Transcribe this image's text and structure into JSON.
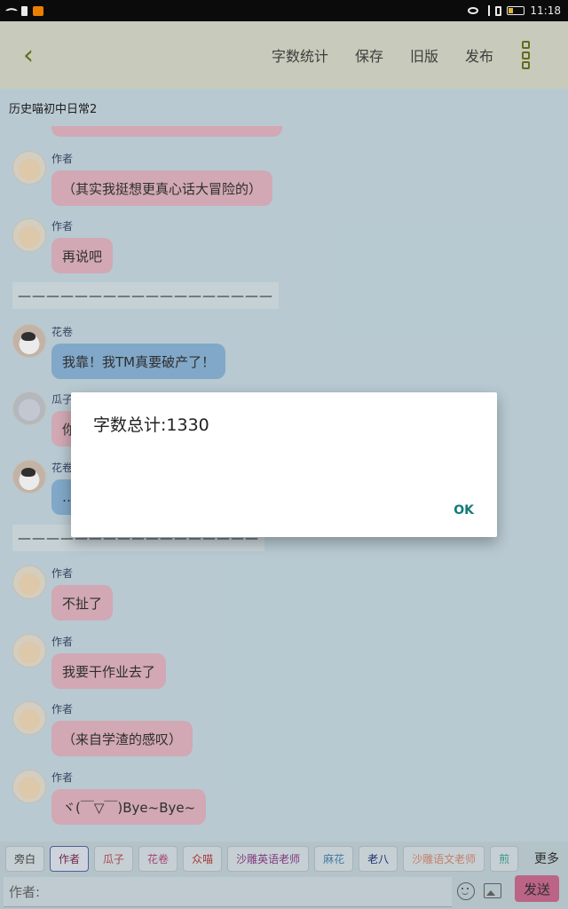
{
  "status_bar": {
    "time": "11:18"
  },
  "header": {
    "back_icon": "chevron-left-icon",
    "actions": [
      "字数统计",
      "保存",
      "旧版",
      "发布"
    ],
    "more_icon": "more-vertical-icon"
  },
  "document_title": "历史喵初中日常2",
  "messages": [
    {
      "speaker": "作者",
      "text": "（其实我挺想更真心话大冒险的）",
      "color": "pink"
    },
    {
      "speaker": "作者",
      "text": "再说吧",
      "color": "pink"
    },
    {
      "divider": "——————————————————"
    },
    {
      "speaker": "花卷",
      "text": "我靠！我TM真要破产了！",
      "color": "blue"
    },
    {
      "speaker": "瓜子",
      "text": "你",
      "color": "pink"
    },
    {
      "speaker": "花卷",
      "text": "…",
      "color": "blue"
    },
    {
      "divider": "—————————————————"
    },
    {
      "speaker": "作者",
      "text": "不扯了",
      "color": "pink"
    },
    {
      "speaker": "作者",
      "text": "我要干作业去了",
      "color": "pink"
    },
    {
      "speaker": "作者",
      "text": "（来自学渣的感叹）",
      "color": "pink"
    },
    {
      "speaker": "作者",
      "text": "ヾ(￣▽￣)Bye~Bye~",
      "color": "pink"
    }
  ],
  "dialog": {
    "title": "字数总计:1330",
    "ok_label": "OK"
  },
  "roles": {
    "items": [
      "旁白",
      "作者",
      "瓜子",
      "花卷",
      "众喵",
      "沙雕英语老师",
      "麻花",
      "老八",
      "沙雕语文老师",
      "煎"
    ],
    "selected": "作者",
    "more_label": "更多"
  },
  "input": {
    "placeholder": "作者:",
    "send_label": "发送"
  },
  "colors": {
    "accent": "#6e7520",
    "pink_bubble": "#e3b7c3",
    "blue_bubble": "#8db7da",
    "dialog_button": "#127b7a",
    "send_button": "#cc6d92"
  }
}
